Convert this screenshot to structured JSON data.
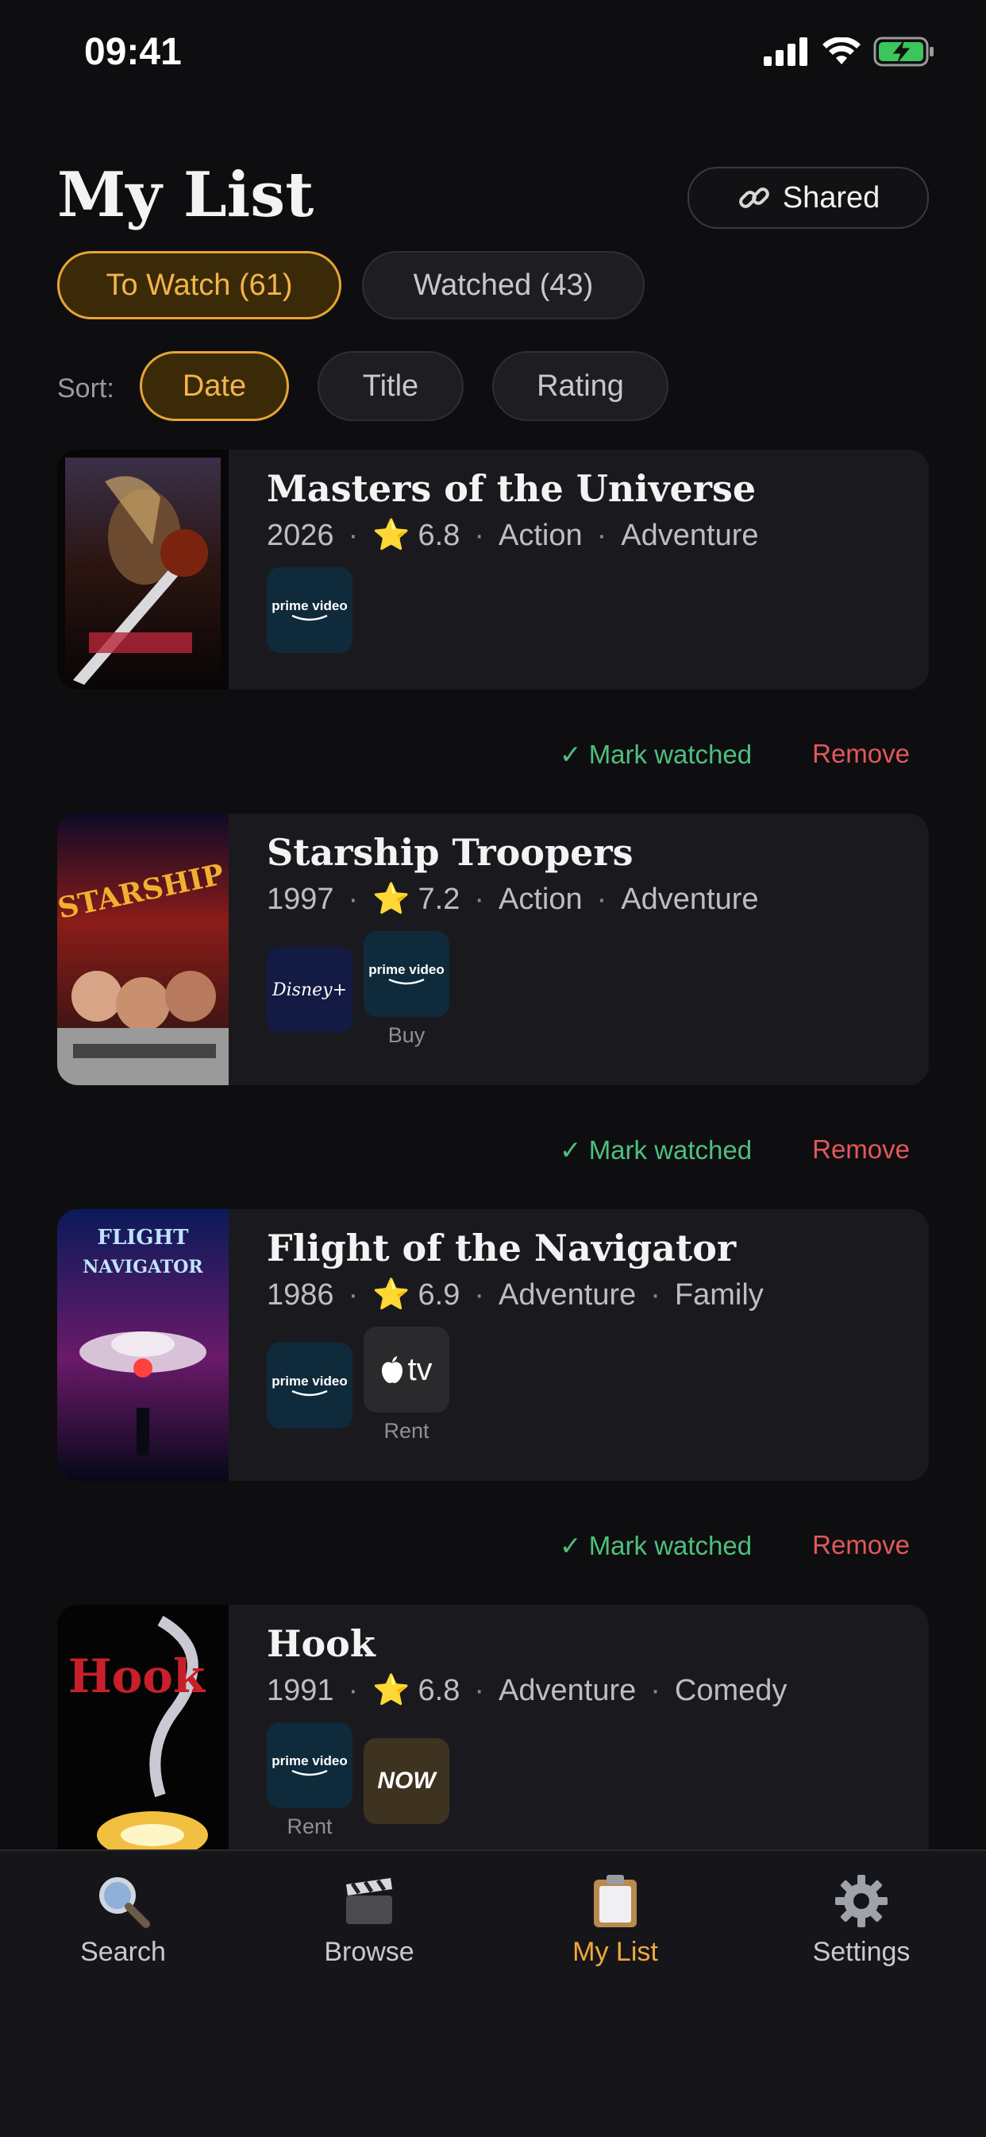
{
  "status_bar": {
    "time": "09:41"
  },
  "header": {
    "title": "My List",
    "shared_label": "Shared"
  },
  "segments": [
    {
      "label": "To Watch (61)",
      "active": true
    },
    {
      "label": "Watched (43)",
      "active": false
    }
  ],
  "sort": {
    "label": "Sort:",
    "options": [
      {
        "label": "Date",
        "active": true
      },
      {
        "label": "Title",
        "active": false
      },
      {
        "label": "Rating",
        "active": false
      }
    ]
  },
  "movies": [
    {
      "title": "Masters of the Universe",
      "year": "2026",
      "rating": "6.8",
      "genres": [
        "Action",
        "Adventure"
      ],
      "providers": [
        {
          "logo": "prime video",
          "caption": ""
        }
      ]
    },
    {
      "title": "Starship Troopers",
      "year": "1997",
      "rating": "7.2",
      "genres": [
        "Action",
        "Adventure"
      ],
      "providers": [
        {
          "logo": "Disney+",
          "caption": ""
        },
        {
          "logo": "prime video",
          "caption": "Buy"
        }
      ]
    },
    {
      "title": "Flight of the Navigator",
      "year": "1986",
      "rating": "6.9",
      "genres": [
        "Adventure",
        "Family"
      ],
      "providers": [
        {
          "logo": "prime video",
          "caption": ""
        },
        {
          "logo": "tv",
          "caption": "Rent"
        }
      ]
    },
    {
      "title": "Hook",
      "year": "1991",
      "rating": "6.8",
      "genres": [
        "Adventure",
        "Comedy"
      ],
      "providers": [
        {
          "logo": "prime video",
          "caption": "Rent"
        },
        {
          "logo": "NOW",
          "caption": ""
        }
      ]
    }
  ],
  "actions": {
    "mark_watched": "✓ Mark watched",
    "remove": "Remove"
  },
  "tabbar": [
    {
      "label": "Search",
      "icon": "magnifier-icon",
      "active": false
    },
    {
      "label": "Browse",
      "icon": "clapperboard-icon",
      "active": false
    },
    {
      "label": "My List",
      "icon": "clipboard-icon",
      "active": true
    },
    {
      "label": "Settings",
      "icon": "gear-icon",
      "active": false
    }
  ],
  "colors": {
    "accent": "#e8a434",
    "background": "#0e0e11",
    "card": "#1a1a1e",
    "mark": "#4fbf7d",
    "remove": "#e2585a"
  }
}
